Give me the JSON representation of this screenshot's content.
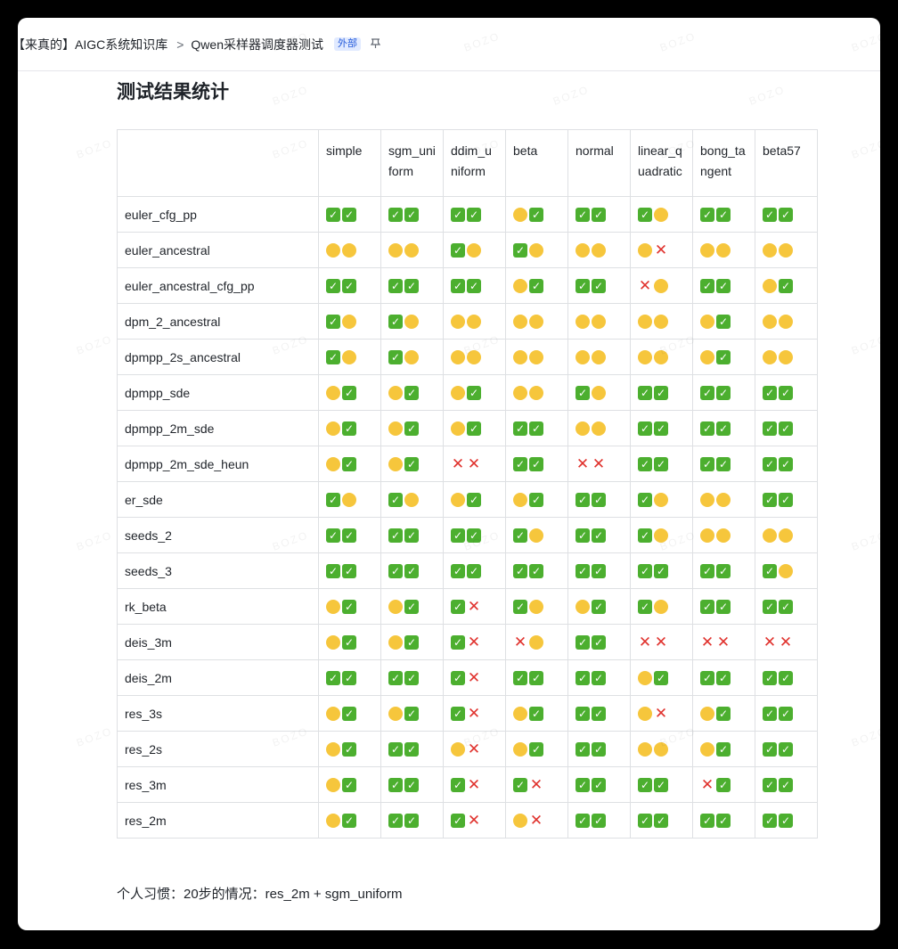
{
  "breadcrumb": {
    "parent": "【来真的】AIGC系统知识库",
    "separator": ">",
    "current": "Qwen采样器调度器测试",
    "badge": "外部"
  },
  "heading": "测试结果统计",
  "table": {
    "columns": [
      "",
      "simple",
      "sgm_un iform",
      "ddim_u niform",
      "beta",
      "normal",
      "linear_q uadratic",
      "bong_ta ngent",
      "beta57"
    ],
    "legend": {
      "Y": "🟡",
      "C": "✅",
      "X": "❌"
    },
    "rows": [
      {
        "name": "euler_cfg_pp",
        "cells": [
          "CC",
          "CC",
          "CC",
          "YC",
          "CC",
          "CY",
          "CC",
          "CC"
        ]
      },
      {
        "name": "euler_ancestral",
        "cells": [
          "YY",
          "YY",
          "CY",
          "CY",
          "YY",
          "YX",
          "YY",
          "YY"
        ]
      },
      {
        "name": "euler_ancestral_cfg_pp",
        "cells": [
          "CC",
          "CC",
          "CC",
          "YC",
          "CC",
          "XY",
          "CC",
          "YC"
        ]
      },
      {
        "name": "dpm_2_ancestral",
        "cells": [
          "CY",
          "CY",
          "YY",
          "YY",
          "YY",
          "YY",
          "YC",
          "YY"
        ]
      },
      {
        "name": "dpmpp_2s_ancestral",
        "cells": [
          "CY",
          "CY",
          "YY",
          "YY",
          "YY",
          "YY",
          "YC",
          "YY"
        ]
      },
      {
        "name": "dpmpp_sde",
        "cells": [
          "YC",
          "YC",
          "YC",
          "YY",
          "CY",
          "CC",
          "CC",
          "CC"
        ]
      },
      {
        "name": "dpmpp_2m_sde",
        "cells": [
          "YC",
          "YC",
          "YC",
          "CC",
          "YY",
          "CC",
          "CC",
          "CC"
        ]
      },
      {
        "name": "dpmpp_2m_sde_heun",
        "cells": [
          "YC",
          "YC",
          "XX",
          "CC",
          "XX",
          "CC",
          "CC",
          "CC"
        ]
      },
      {
        "name": "er_sde",
        "cells": [
          "CY",
          "CY",
          "YC",
          "YC",
          "CC",
          "CY",
          "YY",
          "CC"
        ]
      },
      {
        "name": "seeds_2",
        "cells": [
          "CC",
          "CC",
          "CC",
          "CY",
          "CC",
          "CY",
          "YY",
          "YY"
        ]
      },
      {
        "name": "seeds_3",
        "cells": [
          "CC",
          "CC",
          "CC",
          "CC",
          "CC",
          "CC",
          "CC",
          "CY"
        ]
      },
      {
        "name": "rk_beta",
        "cells": [
          "YC",
          "YC",
          "CX",
          "CY",
          "YC",
          "CY",
          "CC",
          "CC"
        ]
      },
      {
        "name": "deis_3m",
        "cells": [
          "YC",
          "YC",
          "CX",
          "XY",
          "CC",
          "XX",
          "XX",
          "XX"
        ]
      },
      {
        "name": "deis_2m",
        "cells": [
          "CC",
          "CC",
          "CX",
          "CC",
          "CC",
          "YC",
          "CC",
          "CC"
        ]
      },
      {
        "name": "res_3s",
        "cells": [
          "YC",
          "YC",
          "CX",
          "YC",
          "CC",
          "YX",
          "YC",
          "CC"
        ]
      },
      {
        "name": "res_2s",
        "cells": [
          "YC",
          "CC",
          "YX",
          "YC",
          "CC",
          "YY",
          "YC",
          "CC"
        ]
      },
      {
        "name": "res_3m",
        "cells": [
          "YC",
          "CC",
          "CX",
          "CX",
          "CC",
          "CC",
          "XC",
          "CC"
        ]
      },
      {
        "name": "res_2m",
        "cells": [
          "YC",
          "CC",
          "CX",
          "YX",
          "CC",
          "CC",
          "CC",
          "CC"
        ]
      }
    ]
  },
  "note": "个人习惯：20步的情况：res_2m + sgm_uniform",
  "watermark_text": "BOZO",
  "colors": {
    "check": "#4caf2f",
    "dot": "#f6c63c",
    "cross": "#e0322d",
    "badge_bg": "#e1eaff",
    "badge_fg": "#245bdb"
  }
}
